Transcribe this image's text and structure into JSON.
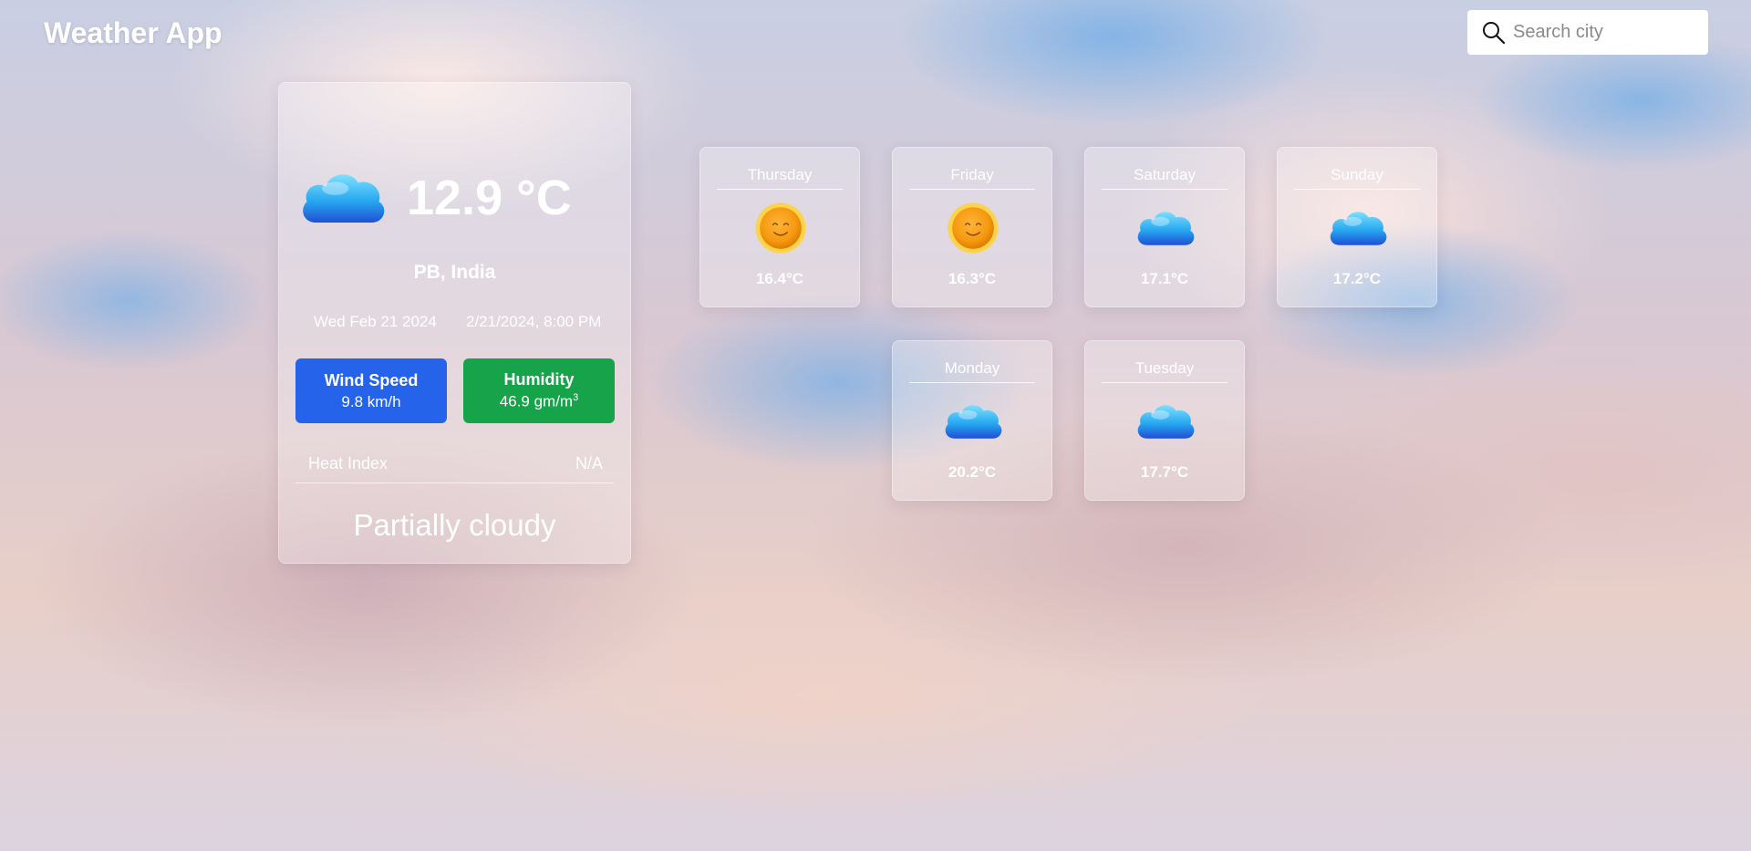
{
  "header": {
    "app_title": "Weather App"
  },
  "search": {
    "placeholder": "Search city",
    "value": ""
  },
  "current": {
    "temperature": "12.9 °C",
    "location": "PB, India",
    "date": "Wed Feb 21 2024",
    "datetime": "2/21/2024, 8:00 PM",
    "icon": "cloud-icon",
    "wind": {
      "label": "Wind Speed",
      "value": "9.8 km/h",
      "color": "#2563eb"
    },
    "humidity": {
      "label": "Humidity",
      "value": "46.9 gm/m",
      "unit_sup": "3",
      "color": "#16a34a"
    },
    "heat_index": {
      "label": "Heat Index",
      "value": "N/A"
    },
    "condition": "Partially cloudy"
  },
  "forecast": [
    {
      "day": "Thursday",
      "temp": "16.4°C",
      "icon": "sun-icon"
    },
    {
      "day": "Friday",
      "temp": "16.3°C",
      "icon": "sun-icon"
    },
    {
      "day": "Saturday",
      "temp": "17.1°C",
      "icon": "cloud-icon"
    },
    {
      "day": "Sunday",
      "temp": "17.2°C",
      "icon": "cloud-icon"
    },
    {
      "day": "Monday",
      "temp": "20.2°C",
      "icon": "cloud-icon"
    },
    {
      "day": "Tuesday",
      "temp": "17.7°C",
      "icon": "cloud-icon"
    }
  ]
}
